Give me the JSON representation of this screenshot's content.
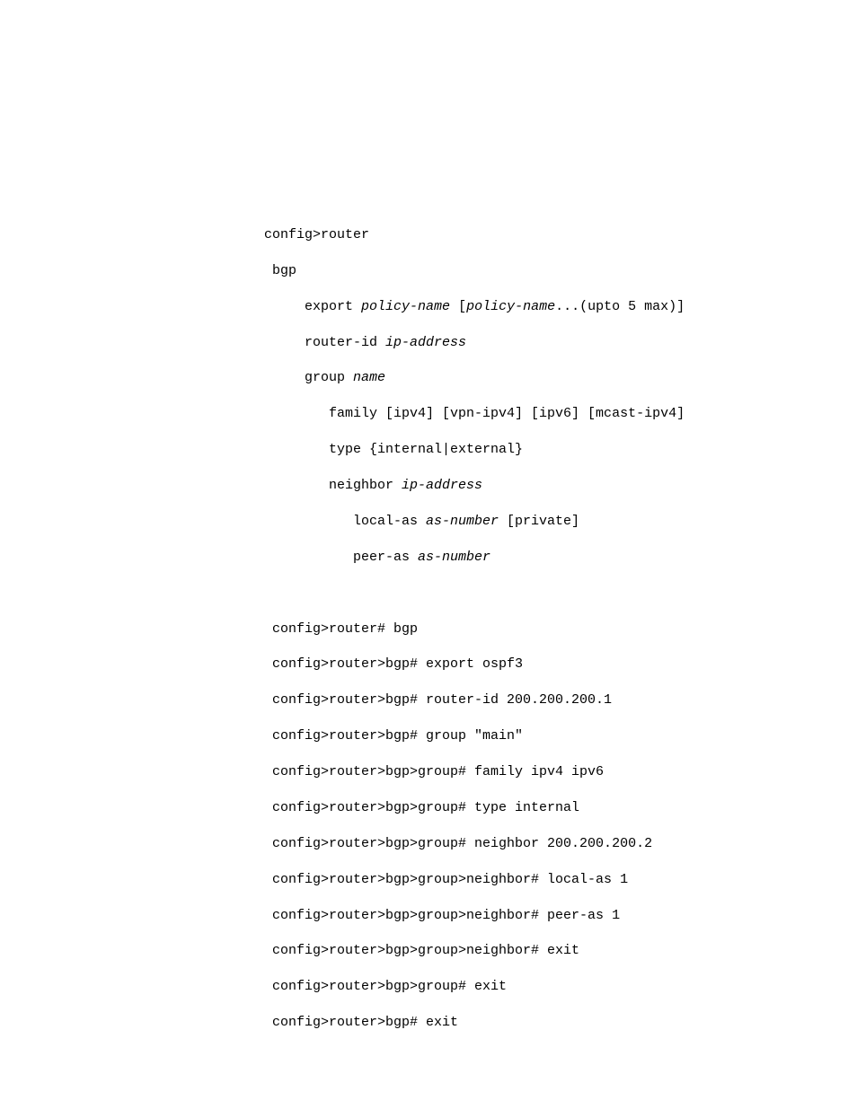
{
  "syntax": {
    "l01": "config>router",
    "l02": " bgp",
    "l03a": "     export ",
    "l03b": "policy-name",
    "l03c": " [",
    "l03d": "policy-name",
    "l03e": "...(upto 5 max)]",
    "l04a": "     router-id ",
    "l04b": "ip-address",
    "l05a": "     group ",
    "l05b": "name",
    "l06": "        family [ipv4] [vpn-ipv4] [ipv6] [mcast-ipv4]",
    "l07": "        type {internal|external}",
    "l08a": "        neighbor ",
    "l08b": "ip-address",
    "l09a": "           local-as ",
    "l09b": "as-number",
    "l09c": " [private]",
    "l10a": "           peer-as ",
    "l10b": "as-number"
  },
  "example": {
    "l01": " config>router# bgp",
    "l02": " config>router>bgp# export ospf3",
    "l03": " config>router>bgp# router-id 200.200.200.1",
    "l04": " config>router>bgp# group \"main\"",
    "l05": " config>router>bgp>group# family ipv4 ipv6",
    "l06": " config>router>bgp>group# type internal",
    "l07": " config>router>bgp>group# neighbor 200.200.200.2",
    "l08": " config>router>bgp>group>neighbor# local-as 1",
    "l09": " config>router>bgp>group>neighbor# peer-as 1",
    "l10": " config>router>bgp>group>neighbor# exit",
    "l11": " config>router>bgp>group# exit",
    "l12": " config>router>bgp# exit"
  }
}
